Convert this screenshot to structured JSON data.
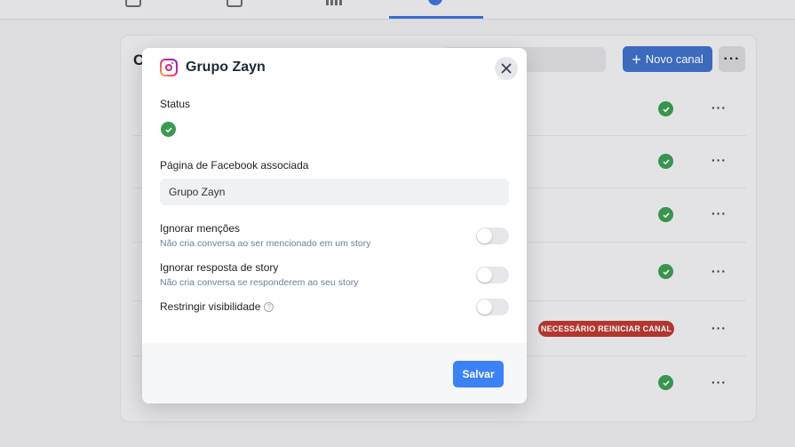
{
  "background": {
    "card_title_fragment": "C",
    "new_channel_label": "Novo canal",
    "more_label": "···",
    "restart_badge": "NECESSÁRIO REINICIAR CANAL",
    "rows": [
      {
        "status": "ok",
        "more": "···"
      },
      {
        "status": "ok",
        "more": "···"
      },
      {
        "status": "ok",
        "more": "···"
      },
      {
        "status": "ok",
        "more": "···"
      },
      {
        "status": "restart",
        "more": "···"
      },
      {
        "status": "ok",
        "more": "···"
      }
    ]
  },
  "modal": {
    "icon": "instagram-icon",
    "title": "Grupo Zayn",
    "status_label": "Status",
    "status_value": "ok",
    "facebook_page_label": "Página de Facebook associada",
    "facebook_page_value": "Grupo Zayn",
    "options": [
      {
        "title": "Ignorar menções",
        "desc": "Não cria conversa ao ser mencionado em um story",
        "enabled": false
      },
      {
        "title": "Ignorar resposta de story",
        "desc": "Não cria conversa se responderem ao seu story",
        "enabled": false
      },
      {
        "title": "Restringir visibilidade",
        "desc": "",
        "enabled": false
      }
    ],
    "save_label": "Salvar"
  },
  "colors": {
    "accent": "#3b82f6",
    "success": "#3a9c52",
    "danger": "#b93a31"
  }
}
